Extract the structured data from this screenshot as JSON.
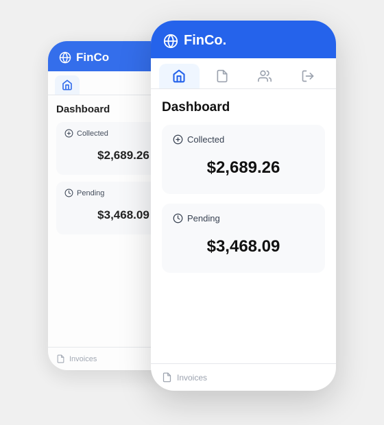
{
  "app": {
    "name": "FinCo.",
    "brand_color": "#2563eb"
  },
  "back_phone": {
    "header": {
      "logo": "globe-icon",
      "title": "FinCo"
    },
    "nav": {
      "items": [
        {
          "label": "home",
          "icon": "home-icon",
          "active": true
        }
      ]
    },
    "page_title": "Dashboard",
    "cards": [
      {
        "label": "Collected",
        "icon": "dollar-icon",
        "value": "$2,689.26"
      },
      {
        "label": "Pending",
        "icon": "clock-icon",
        "value": "$3,468.09"
      }
    ],
    "bottom_nav": {
      "icon": "doc-icon",
      "label": "Invoices"
    }
  },
  "front_phone": {
    "header": {
      "logo": "globe-icon",
      "title": "FinCo."
    },
    "nav": {
      "items": [
        {
          "label": "home",
          "icon": "home-icon",
          "active": true
        },
        {
          "label": "documents",
          "icon": "doc-icon",
          "active": false
        },
        {
          "label": "users",
          "icon": "users-icon",
          "active": false
        },
        {
          "label": "logout",
          "icon": "logout-icon",
          "active": false
        }
      ]
    },
    "page_title": "Dashboard",
    "cards": [
      {
        "label": "Collected",
        "icon": "dollar-icon",
        "value": "$2,689.26"
      },
      {
        "label": "Pending",
        "icon": "clock-icon",
        "value": "$3,468.09"
      }
    ],
    "bottom_nav": {
      "icon": "doc-icon",
      "label": "Invoices"
    }
  }
}
